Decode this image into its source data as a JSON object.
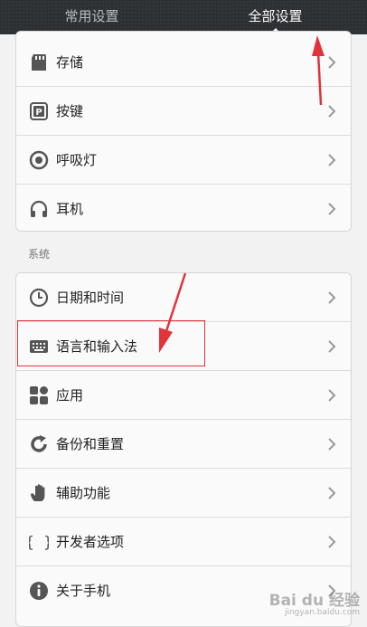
{
  "tabs": {
    "common": "常用设置",
    "all": "全部设置"
  },
  "section_system": "系统",
  "group1": [
    {
      "label": "存储",
      "icon": "sd-card-icon"
    },
    {
      "label": "按键",
      "icon": "key-button-icon"
    },
    {
      "label": "呼吸灯",
      "icon": "notification-light-icon"
    },
    {
      "label": "耳机",
      "icon": "headphones-icon"
    }
  ],
  "group2": [
    {
      "label": "日期和时间",
      "icon": "clock-icon"
    },
    {
      "label": "语言和输入法",
      "icon": "keyboard-icon"
    },
    {
      "label": "应用",
      "icon": "apps-icon"
    },
    {
      "label": "备份和重置",
      "icon": "backup-reset-icon"
    },
    {
      "label": "辅助功能",
      "icon": "hand-icon"
    },
    {
      "label": "开发者选项",
      "icon": "braces-icon"
    },
    {
      "label": "关于手机",
      "icon": "info-icon"
    }
  ],
  "watermark": {
    "brand": "Bai du 经验",
    "url": "jingyan.baidu.com"
  },
  "colors": {
    "tabbar": "#2d3033",
    "annotation": "#e0343a",
    "icon": "#555555"
  }
}
